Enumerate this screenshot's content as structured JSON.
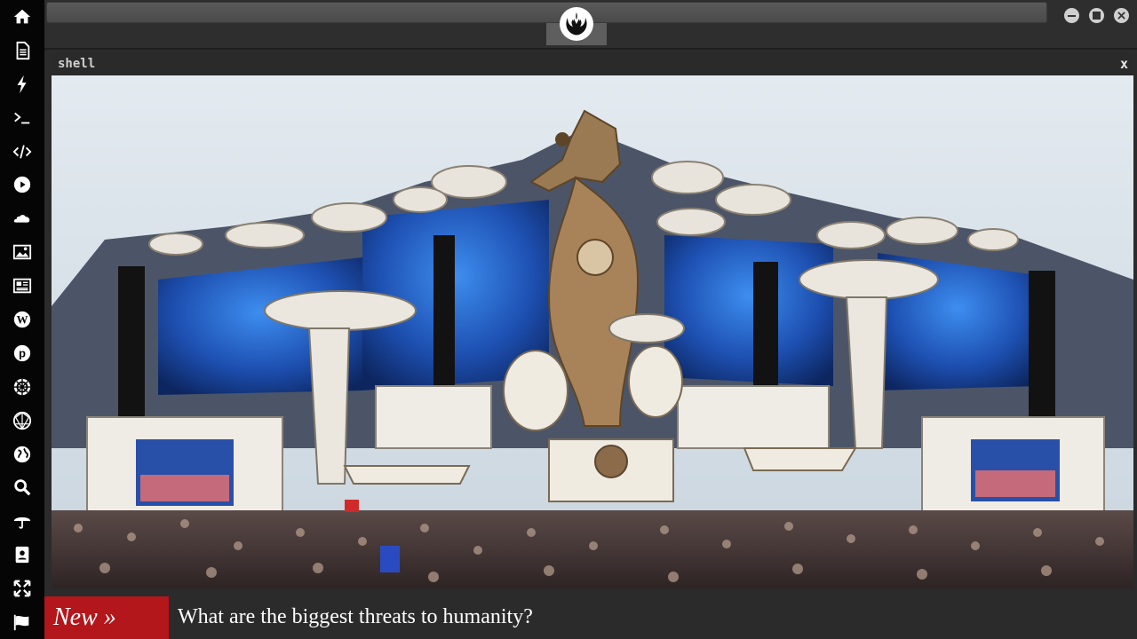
{
  "shell": {
    "title": "shell",
    "close_label": "x"
  },
  "ticker": {
    "badge": "New »",
    "headline": "What are the biggest threats to humanity?"
  },
  "sidebar": {
    "items": [
      {
        "icon": "home-icon"
      },
      {
        "icon": "document-icon"
      },
      {
        "icon": "lightning-icon"
      },
      {
        "icon": "terminal-icon"
      },
      {
        "icon": "code-icon"
      },
      {
        "icon": "play-icon"
      },
      {
        "icon": "cloud-icon"
      },
      {
        "icon": "image-icon"
      },
      {
        "icon": "newspaper-icon"
      },
      {
        "icon": "wordpress-icon"
      },
      {
        "icon": "pinterest-icon"
      },
      {
        "icon": "empire-icon"
      },
      {
        "icon": "sphere-icon"
      },
      {
        "icon": "globe-icon"
      },
      {
        "icon": "search-icon"
      },
      {
        "icon": "umbrella-icon"
      },
      {
        "icon": "contact-icon"
      },
      {
        "icon": "fullscreen-icon"
      },
      {
        "icon": "flag-icon"
      }
    ]
  },
  "colors": {
    "rail_bg": "#050505",
    "badge_bg": "#b3161b",
    "sky": "#d9e3ea",
    "screen_blue": "#1f5fc4"
  }
}
